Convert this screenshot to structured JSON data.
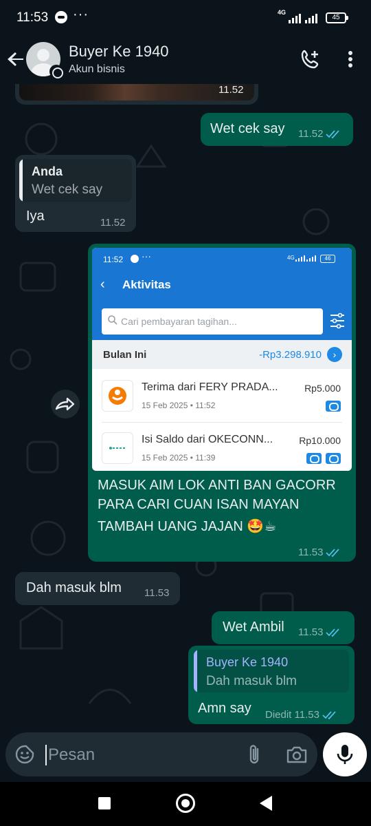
{
  "status_bar": {
    "time": "11:53",
    "more": "···",
    "network": "4G",
    "battery": "45"
  },
  "header": {
    "contact_name": "Buyer Ke 1940",
    "contact_subtitle": "Akun bisnis"
  },
  "messages": [
    {
      "id": "m0",
      "type": "image-partial",
      "direction": "in",
      "time": "11.52"
    },
    {
      "id": "m1",
      "type": "text",
      "direction": "out",
      "text": "Wet cek say",
      "time": "11.52",
      "read": true
    },
    {
      "id": "m2",
      "type": "reply",
      "direction": "in",
      "quoted_name": "Anda",
      "quoted_text": "Wet cek say",
      "text": "Iya",
      "time": "11.52"
    },
    {
      "id": "m3",
      "type": "image-caption",
      "direction": "out",
      "caption_lines": [
        "MASUK AIM LOK ANTI BAN GACORR",
        "PARA CARI CUAN ISAN MAYAN",
        "TAMBAH UANG JAJAN 🤩☕"
      ],
      "time": "11.53",
      "read": true
    },
    {
      "id": "m4",
      "type": "text",
      "direction": "in",
      "text": "Dah masuk blm",
      "time": "11.53"
    },
    {
      "id": "m5",
      "type": "text",
      "direction": "out",
      "text": "Wet Ambil",
      "time": "11.53",
      "read": true
    },
    {
      "id": "m6",
      "type": "reply",
      "direction": "out",
      "quoted_name": "Buyer Ke 1940",
      "quoted_text": "Dah masuk blm",
      "text": "Amn say",
      "edited_label": "Diedit",
      "time": "11.53",
      "read": true
    }
  ],
  "screenshot": {
    "time": "11:52",
    "more": "···",
    "network": "4G",
    "battery": "46",
    "title": "Aktivitas",
    "search_placeholder": "Cari pembayaran tagihan...",
    "month_label": "Bulan Ini",
    "month_total": "-Rp3.298.910",
    "transactions": [
      {
        "title": "Terima dari FERY PRADA...",
        "date": "15 Feb 2025 • 11:52",
        "amount": "Rp5.000"
      },
      {
        "title": "Isi Saldo dari OKECONN...",
        "date": "15 Feb 2025 • 11:39",
        "amount": "Rp10.000"
      }
    ]
  },
  "input": {
    "placeholder": "Pesan"
  },
  "colors": {
    "background": "#0b141a",
    "outgoing_bubble": "#005c4b",
    "incoming_bubble": "#202c33",
    "tick_read": "#53bdeb",
    "app_blue": "#1976d2"
  },
  "icons": [
    "back-arrow-icon",
    "business-badge-icon",
    "add-call-icon",
    "more-vert-icon",
    "forward-icon",
    "search-icon",
    "filter-icon",
    "sticker-icon",
    "attach-icon",
    "camera-icon",
    "mic-icon"
  ]
}
